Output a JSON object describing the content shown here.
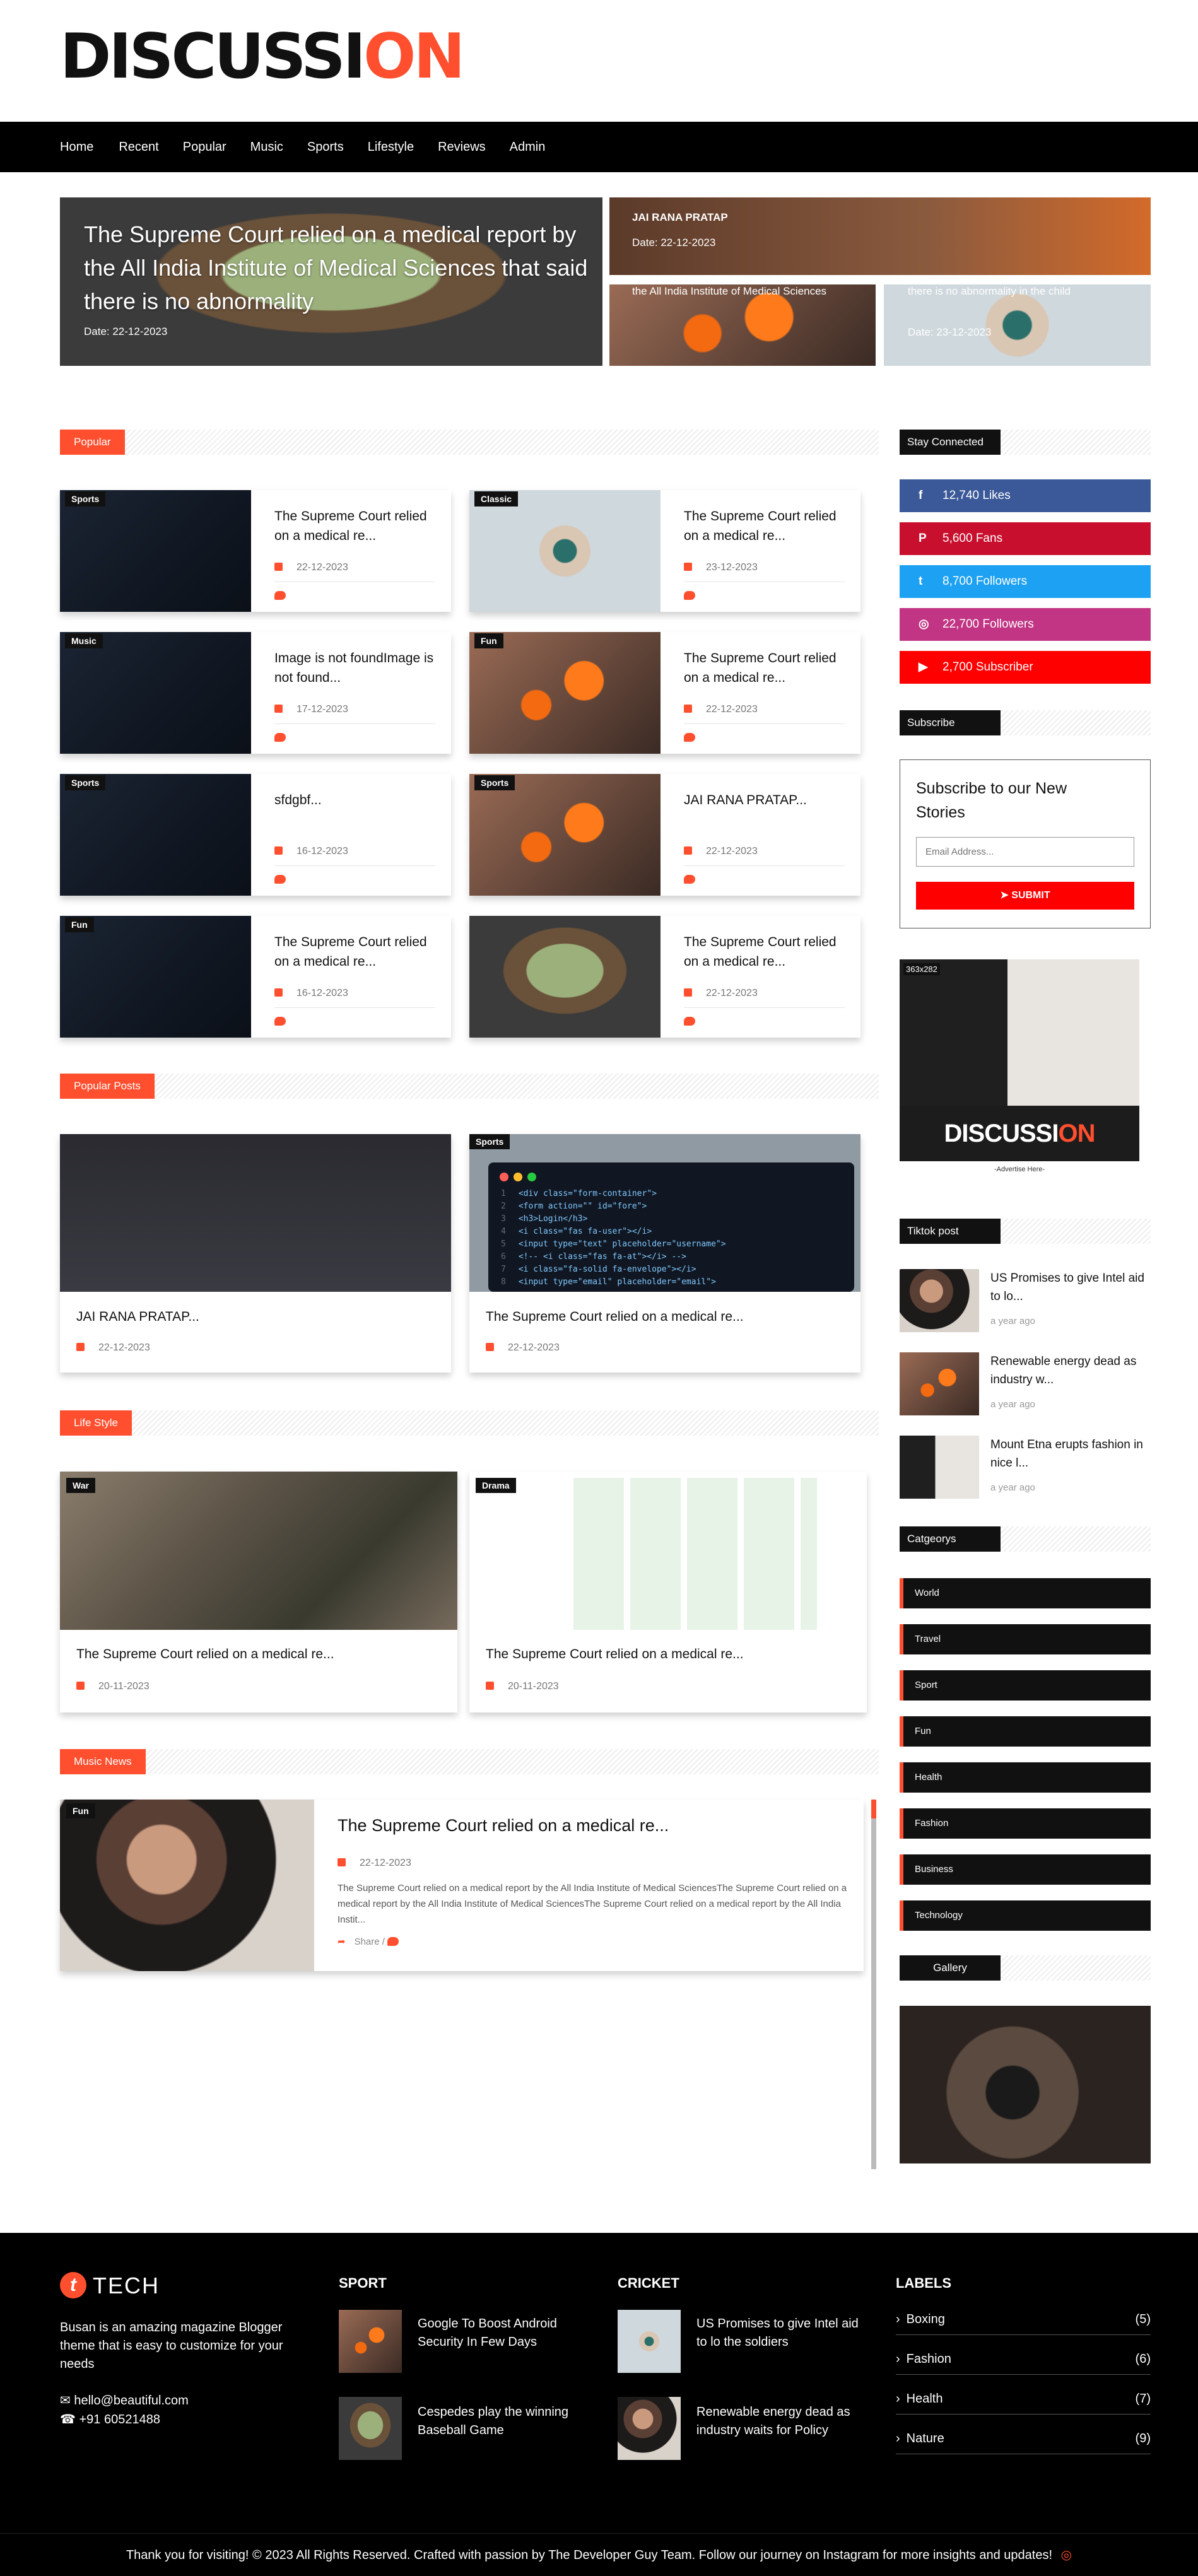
{
  "brand": {
    "logo_a": "DISCUSSI",
    "logo_o": "O",
    "logo_b": "N"
  },
  "nav": [
    "Home",
    "Recent",
    "Popular",
    "Music",
    "Sports",
    "Lifestyle",
    "Reviews",
    "Admin"
  ],
  "hero": {
    "main": {
      "title": "The Supreme Court relied on a medical report by the All India Institute of Medical Sciences that said there is no abnormality",
      "date": "Date: 22-12-2023"
    },
    "tr": {
      "title": "JAI RANA PRATAP",
      "date": "Date: 22-12-2023"
    },
    "bl": {
      "title": "The Supreme Court relied on a medical report by the All India Institute of Medical Sciences"
    },
    "br": {
      "title": "The Supreme Court relied on a medical report by the All India Institute of Medical Sciences that said there is no abnormality in the child",
      "date": "Date: 23-12-2023"
    }
  },
  "sections": {
    "popular": "Popular",
    "popular_posts": "Popular Posts",
    "life_style": "Life Style",
    "music_news": "Music News"
  },
  "popular": [
    {
      "badge": "Sports",
      "title": "The Supreme Court relied on a medical re...",
      "date": "22-12-2023"
    },
    {
      "badge": "Classic",
      "title": "The Supreme Court relied on a medical re...",
      "date": "23-12-2023"
    },
    {
      "badge": "Music",
      "title": "Image is not foundImage is not found...",
      "date": "17-12-2023"
    },
    {
      "badge": "Fun",
      "title": "The Supreme Court relied on a medical re...",
      "date": "22-12-2023"
    },
    {
      "badge": "Sports",
      "title": "sfdgbf...",
      "date": "16-12-2023"
    },
    {
      "badge": "Sports",
      "title": "JAI RANA PRATAP...",
      "date": "22-12-2023"
    },
    {
      "badge": "Fun",
      "title": "The Supreme Court relied on a medical re...",
      "date": "16-12-2023"
    },
    {
      "badge": "",
      "title": "The Supreme Court relied on a medical re...",
      "date": "22-12-2023"
    }
  ],
  "popular_posts": [
    {
      "badge": "",
      "title": "JAI RANA PRATAP...",
      "date": "22-12-2023"
    },
    {
      "badge": "Sports",
      "title": "The Supreme Court relied on a medical re...",
      "date": "22-12-2023"
    }
  ],
  "life_style": [
    {
      "badge": "War",
      "title": "The Supreme Court relied on a medical re...",
      "date": "20-11-2023"
    },
    {
      "badge": "Drama",
      "title": "The Supreme Court relied on a medical re...",
      "date": "20-11-2023"
    }
  ],
  "music": {
    "badge": "Fun",
    "title": "The Supreme Court relied on a medical re...",
    "date": "22-12-2023",
    "excerpt": "The Supreme Court relied on a medical report by the All India Institute of Medical SciencesThe Supreme Court relied on a medical report by the All India Institute of Medical SciencesThe Supreme Court relied on a medical report by the All India Instit...",
    "share": "Share /"
  },
  "code_lines": [
    "<div class=\"form-container\">",
    "<form action=\"\" id=\"fore\">",
    "<h3>Login</h3>",
    "<i class=\"fas fa-user\"></i>",
    "<input type=\"text\" placeholder=\"username\">",
    "<!-- <i class=\"fas fa-at\"></i> -->",
    "<i class=\"fa-solid fa-envelope\"></i>",
    "<input type=\"email\" placeholder=\"email\">"
  ],
  "sidebar": {
    "stay_connected": "Stay Connected",
    "social": [
      {
        "icon": "f",
        "label": "12,740 Likes",
        "color": "#3b5998"
      },
      {
        "icon": "P",
        "label": "5,600 Fans",
        "color": "#c8102e"
      },
      {
        "icon": "t",
        "label": "8,700 Followers",
        "color": "#1da1f2"
      },
      {
        "icon": "◎",
        "label": "22,700 Followers",
        "color": "#c13584"
      },
      {
        "icon": "▶",
        "label": "2,700 Subscriber",
        "color": "#ff0000"
      }
    ],
    "subscribe_title": "Subscribe",
    "subscribe_heading": "Subscribe to our New Stories",
    "email_placeholder": "Email Address...",
    "submit": "SUBMIT",
    "ad_size": "363x282",
    "ad_caption": "-Advertise Here-",
    "tiktok_title": "Tiktok post",
    "tiktok": [
      {
        "title": "US Promises to give Intel aid to lo...",
        "time": "a year ago"
      },
      {
        "title": "Renewable energy dead as industry w...",
        "time": "a year ago"
      },
      {
        "title": "Mount Etna erupts fashion in nice l...",
        "time": "a year ago"
      }
    ],
    "categories_title": "Catgeorys",
    "categories": [
      "World",
      "Travel",
      "Sport",
      "Fun",
      "Health",
      "Fashion",
      "Business",
      "Technology"
    ],
    "gallery_title": "Gallery"
  },
  "footer": {
    "brand": "TECH",
    "about": "Busan is an amazing magazine Blogger theme that is easy to customize for your needs",
    "email": "hello@beautiful.com",
    "phone": "+91 60521488",
    "sport_title": "SPORT",
    "sport": [
      "Google To Boost Android Security In Few Days",
      "Cespedes play the winning Baseball Game"
    ],
    "cricket_title": "CRICKET",
    "cricket": [
      "US Promises to give Intel aid to lo the soldiers",
      "Renewable energy dead as industry waits for Policy"
    ],
    "labels_title": "LABELS",
    "labels": [
      {
        "name": "Boxing",
        "count": "(5)"
      },
      {
        "name": "Fashion",
        "count": "(6)"
      },
      {
        "name": "Health",
        "count": "(7)"
      },
      {
        "name": "Nature",
        "count": "(9)"
      }
    ],
    "copyright": "Thank you for visiting! © 2023 All Rights Reserved. Crafted with passion by The Developer Guy Team. Follow our journey on Instagram for more insights and updates!"
  },
  "colors": {
    "accent": "#ff4f2f",
    "dark": "#000000"
  }
}
